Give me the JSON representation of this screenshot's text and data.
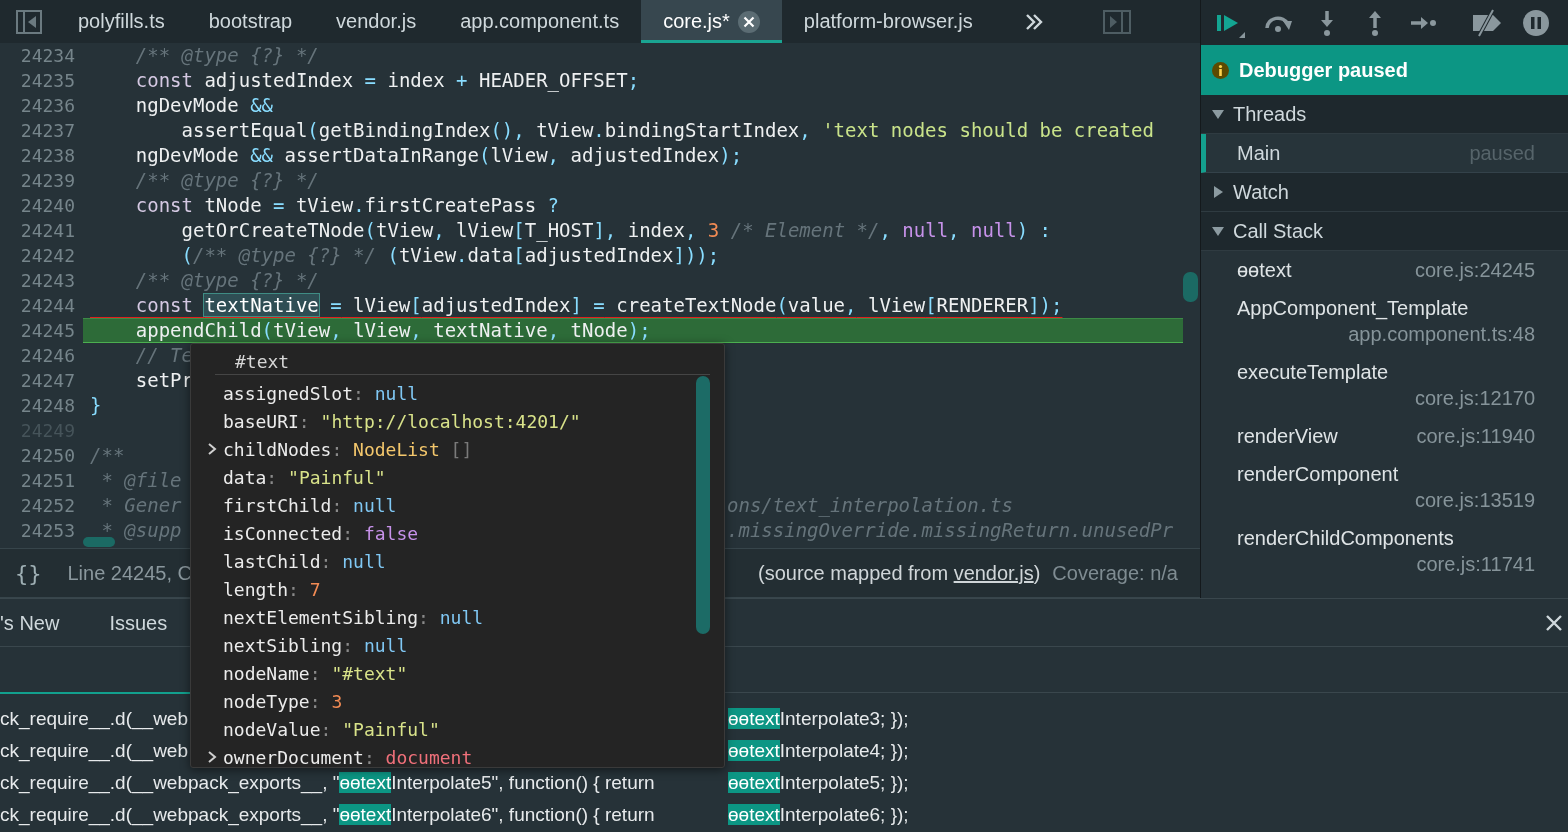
{
  "editor": {
    "tabs": [
      {
        "label": "polyfills.ts",
        "selected": false
      },
      {
        "label": "bootstrap",
        "selected": false
      },
      {
        "label": "vendor.js",
        "selected": false
      },
      {
        "label": "app.component.ts",
        "selected": false
      },
      {
        "label": "core.js*",
        "selected": true
      },
      {
        "label": "platform-browser.js",
        "selected": false
      }
    ],
    "lines": [
      {
        "number": "24234",
        "kind": "normal",
        "segments": [
          {
            "kind": "cm",
            "text": "    /** @type {?} */"
          }
        ]
      },
      {
        "number": "24235",
        "kind": "normal",
        "segments": [
          {
            "kind": "kw",
            "text": "    const"
          },
          {
            "kind": "id",
            "text": " adjustedIndex "
          },
          {
            "kind": "op",
            "text": "="
          },
          {
            "kind": "id",
            "text": " index "
          },
          {
            "kind": "op",
            "text": "+"
          },
          {
            "kind": "id",
            "text": " HEADER_OFFSET"
          },
          {
            "kind": "op",
            "text": ";"
          }
        ]
      },
      {
        "number": "24236",
        "kind": "normal",
        "segments": [
          {
            "kind": "id",
            "text": "    ngDevMode "
          },
          {
            "kind": "op",
            "text": "&&"
          }
        ]
      },
      {
        "number": "24237",
        "kind": "normal",
        "segments": [
          {
            "kind": "id",
            "text": "        assertEqual"
          },
          {
            "kind": "op",
            "text": "("
          },
          {
            "kind": "id",
            "text": "getBindingIndex"
          },
          {
            "kind": "op",
            "text": "(),"
          },
          {
            "kind": "id",
            "text": " tView"
          },
          {
            "kind": "op",
            "text": "."
          },
          {
            "kind": "id",
            "text": "bindingStartIndex"
          },
          {
            "kind": "op",
            "text": ","
          },
          {
            "kind": "str",
            "text": " 'text nodes should be created"
          }
        ]
      },
      {
        "number": "24238",
        "kind": "normal",
        "segments": [
          {
            "kind": "id",
            "text": "    ngDevMode "
          },
          {
            "kind": "op",
            "text": "&&"
          },
          {
            "kind": "id",
            "text": " assertDataInRange"
          },
          {
            "kind": "op",
            "text": "("
          },
          {
            "kind": "id",
            "text": "lView"
          },
          {
            "kind": "op",
            "text": ","
          },
          {
            "kind": "id",
            "text": " adjustedIndex"
          },
          {
            "kind": "op",
            "text": ");"
          }
        ]
      },
      {
        "number": "24239",
        "kind": "normal",
        "segments": [
          {
            "kind": "cm",
            "text": "    /** @type {?} */"
          }
        ]
      },
      {
        "number": "24240",
        "kind": "normal",
        "segments": [
          {
            "kind": "kw",
            "text": "    const"
          },
          {
            "kind": "id",
            "text": " tNode "
          },
          {
            "kind": "op",
            "text": "="
          },
          {
            "kind": "id",
            "text": " tView"
          },
          {
            "kind": "op",
            "text": "."
          },
          {
            "kind": "id",
            "text": "firstCreatePass "
          },
          {
            "kind": "op",
            "text": "?"
          }
        ]
      },
      {
        "number": "24241",
        "kind": "normal",
        "segments": [
          {
            "kind": "id",
            "text": "        getOrCreateTNode"
          },
          {
            "kind": "op",
            "text": "("
          },
          {
            "kind": "id",
            "text": "tView"
          },
          {
            "kind": "op",
            "text": ","
          },
          {
            "kind": "id",
            "text": " lView"
          },
          {
            "kind": "op",
            "text": "["
          },
          {
            "kind": "id",
            "text": "T_HOST"
          },
          {
            "kind": "op",
            "text": "],"
          },
          {
            "kind": "id",
            "text": " index"
          },
          {
            "kind": "op",
            "text": ","
          },
          {
            "kind": "num",
            "text": " 3 "
          },
          {
            "kind": "cm",
            "text": "/* Element */"
          },
          {
            "kind": "op",
            "text": ","
          },
          {
            "kind": "lit",
            "text": " null"
          },
          {
            "kind": "op",
            "text": ","
          },
          {
            "kind": "lit",
            "text": " null"
          },
          {
            "kind": "op",
            "text": ") :"
          }
        ]
      },
      {
        "number": "24242",
        "kind": "normal",
        "segments": [
          {
            "kind": "op",
            "text": "        ("
          },
          {
            "kind": "cm",
            "text": "/** @type {?} */"
          },
          {
            "kind": "op",
            "text": " ("
          },
          {
            "kind": "id",
            "text": "tView"
          },
          {
            "kind": "op",
            "text": "."
          },
          {
            "kind": "id",
            "text": "data"
          },
          {
            "kind": "op",
            "text": "["
          },
          {
            "kind": "id",
            "text": "adjustedIndex"
          },
          {
            "kind": "op",
            "text": "]));"
          }
        ]
      },
      {
        "number": "24243",
        "kind": "normal",
        "segments": [
          {
            "kind": "cm",
            "text": "    /** @type {?} */"
          }
        ]
      },
      {
        "number": "24244",
        "kind": "underlined",
        "segments": [
          {
            "kind": "kw",
            "text": "    const "
          },
          {
            "kind": "hl",
            "text": "textNative"
          },
          {
            "kind": "op",
            "text": " ="
          },
          {
            "kind": "id",
            "text": " lView"
          },
          {
            "kind": "op",
            "text": "["
          },
          {
            "kind": "id",
            "text": "adjustedIndex"
          },
          {
            "kind": "op",
            "text": "] ="
          },
          {
            "kind": "id",
            "text": " createTextNode"
          },
          {
            "kind": "op",
            "text": "("
          },
          {
            "kind": "id",
            "text": "value"
          },
          {
            "kind": "op",
            "text": ","
          },
          {
            "kind": "id",
            "text": " lView"
          },
          {
            "kind": "op",
            "text": "["
          },
          {
            "kind": "id",
            "text": "RENDERER"
          },
          {
            "kind": "op",
            "text": "]);"
          }
        ]
      },
      {
        "number": "24245",
        "kind": "current",
        "segments": [
          {
            "kind": "id",
            "text": "    appendChild"
          },
          {
            "kind": "op",
            "text": "("
          },
          {
            "kind": "id",
            "text": "tView"
          },
          {
            "kind": "op",
            "text": ","
          },
          {
            "kind": "id",
            "text": " lView"
          },
          {
            "kind": "op",
            "text": ","
          },
          {
            "kind": "id",
            "text": " textNative"
          },
          {
            "kind": "op",
            "text": ","
          },
          {
            "kind": "id",
            "text": " tNode"
          },
          {
            "kind": "op",
            "text": ");"
          }
        ]
      },
      {
        "number": "24246",
        "kind": "normal",
        "segments": [
          {
            "kind": "cm",
            "text": "    // Te"
          }
        ]
      },
      {
        "number": "24247",
        "kind": "normal",
        "segments": [
          {
            "kind": "id",
            "text": "    setPr"
          }
        ]
      },
      {
        "number": "24248",
        "kind": "normal",
        "segments": [
          {
            "kind": "op",
            "text": "}"
          }
        ]
      },
      {
        "number": "24249",
        "kind": "muted"
      },
      {
        "number": "24250",
        "kind": "normal",
        "segments": [
          {
            "kind": "cm",
            "text": "/**"
          }
        ]
      },
      {
        "number": "24251",
        "kind": "normal",
        "segments": [
          {
            "kind": "cm",
            "text": " * @file"
          }
        ]
      },
      {
        "number": "24252",
        "kind": "normal",
        "segments": [
          {
            "kind": "cm",
            "text": " * Gener"
          }
        ],
        "tail": [
          {
            "kind": "cm",
            "text": "ons/text_interpolation.ts"
          }
        ]
      },
      {
        "number": "24253",
        "kind": "normal",
        "segments": [
          {
            "kind": "cm",
            "text": " * @supp"
          }
        ],
        "tail": [
          {
            "kind": "cm",
            "text": ".missingOverride.missingReturn.unusedPr"
          }
        ]
      }
    ],
    "status": {
      "pretty_print": "{}",
      "position": "Line 24245, C",
      "source_prefix": "(source mapped from ",
      "source_link": "vendor.js",
      "source_suffix": ")",
      "coverage": "Coverage: n/a"
    }
  },
  "popover": {
    "title": "#text",
    "separator": ": ",
    "properties": [
      {
        "name": "assignedSlot",
        "value": "null",
        "kind": "null",
        "expandable": false
      },
      {
        "name": "baseURI",
        "value": "\"http://localhost:4201/\"",
        "kind": "str",
        "expandable": false
      },
      {
        "name": "childNodes",
        "value": "NodeList",
        "extra": "[]",
        "kind": "obj",
        "expandable": true
      },
      {
        "name": "data",
        "value": "\"Painful\"",
        "kind": "str",
        "expandable": false
      },
      {
        "name": "firstChild",
        "value": "null",
        "kind": "null",
        "expandable": false
      },
      {
        "name": "isConnected",
        "value": "false",
        "kind": "bool",
        "expandable": false
      },
      {
        "name": "lastChild",
        "value": "null",
        "kind": "null",
        "expandable": false
      },
      {
        "name": "length",
        "value": "7",
        "kind": "num",
        "expandable": false
      },
      {
        "name": "nextElementSibling",
        "value": "null",
        "kind": "null",
        "expandable": false
      },
      {
        "name": "nextSibling",
        "value": "null",
        "kind": "null",
        "expandable": false
      },
      {
        "name": "nodeName",
        "value": "\"#text\"",
        "kind": "str",
        "expandable": false
      },
      {
        "name": "nodeType",
        "value": "3",
        "kind": "num",
        "expandable": false
      },
      {
        "name": "nodeValue",
        "value": "\"Painful\"",
        "kind": "str",
        "expandable": false
      },
      {
        "name": "ownerDocument",
        "value": "document",
        "kind": "ref",
        "expandable": true
      }
    ]
  },
  "debugger": {
    "banner": "Debugger paused",
    "threads": {
      "title": "Threads",
      "expanded": true,
      "items": [
        {
          "name": "Main",
          "status": "paused",
          "selected": true
        }
      ]
    },
    "watch": {
      "title": "Watch",
      "expanded": false
    },
    "call_stack": {
      "title": "Call Stack",
      "expanded": true,
      "frames": [
        {
          "name": "ɵɵtext",
          "location": "core.js:24245"
        },
        {
          "name": "AppComponent_Template",
          "location": "app.component.ts:48"
        },
        {
          "name": "executeTemplate",
          "location": "core.js:12170"
        },
        {
          "name": "renderView",
          "location": "core.js:11940"
        },
        {
          "name": "renderComponent",
          "location": "core.js:13519"
        },
        {
          "name": "renderChildComponents",
          "location": "core.js:11741"
        }
      ]
    }
  },
  "drawer": {
    "tabs": [
      "'s New",
      "Issues"
    ],
    "console": [
      {
        "head": [
          {
            "text": "ck_require__.d(__web",
            "match": false
          }
        ],
        "tail": [
          {
            "text": "ɵɵtext",
            "match": true
          },
          {
            "text": "Interpolate3; });",
            "match": false
          }
        ]
      },
      {
        "head": [
          {
            "text": "ck_require__.d(__web",
            "match": false
          }
        ],
        "tail": [
          {
            "text": "ɵɵtext",
            "match": true
          },
          {
            "text": "Interpolate4; });",
            "match": false
          }
        ]
      },
      {
        "head": [
          {
            "text": "ck_require__.d(__webpack_exports__, \"",
            "match": false
          },
          {
            "text": "ɵɵtext",
            "match": true
          },
          {
            "text": "Interpolate5\", function() { return ",
            "match": false
          }
        ],
        "tail": [
          {
            "text": "ɵɵtext",
            "match": true
          },
          {
            "text": "Interpolate5; });",
            "match": false
          }
        ]
      },
      {
        "head": [
          {
            "text": "ck_require__.d(__webpack_exports__, \"",
            "match": false
          },
          {
            "text": "ɵɵtext",
            "match": true
          },
          {
            "text": "Interpolate6\", function() { return ",
            "match": false
          }
        ],
        "tail": [
          {
            "text": "ɵɵtext",
            "match": true
          },
          {
            "text": "Interpolate6; });",
            "match": false
          }
        ]
      }
    ]
  }
}
